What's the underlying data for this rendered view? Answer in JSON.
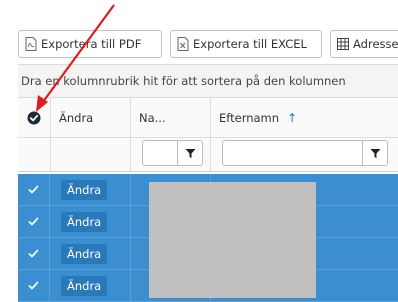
{
  "toolbar": {
    "pdf_label": "Exportera till PDF",
    "excel_label": "Exportera till EXCEL",
    "address_label": "Adresse"
  },
  "group_hint": "Dra en kolumnrubrik hit för att sortera på den kolumnen",
  "columns": {
    "edit": "Ändra",
    "firstname": "Na...",
    "lastname": "Efternamn",
    "lastname_sort": "↑"
  },
  "rows": [
    {
      "edit": "Ändra",
      "selected": true
    },
    {
      "edit": "Ändra",
      "selected": true
    },
    {
      "edit": "Ändra",
      "selected": true
    },
    {
      "edit": "Ändra",
      "selected": true
    }
  ],
  "colors": {
    "selected_row": "#3b8fd0",
    "edit_button": "#2979b8",
    "annotation_arrow": "#e01b1b"
  },
  "icons": {
    "pdf": "pdf-file-icon",
    "excel": "excel-file-icon",
    "address": "grid-table-icon",
    "filter": "funnel-filter-icon",
    "select_all": "select-all-checked-icon",
    "row_check": "checkmark-icon"
  }
}
